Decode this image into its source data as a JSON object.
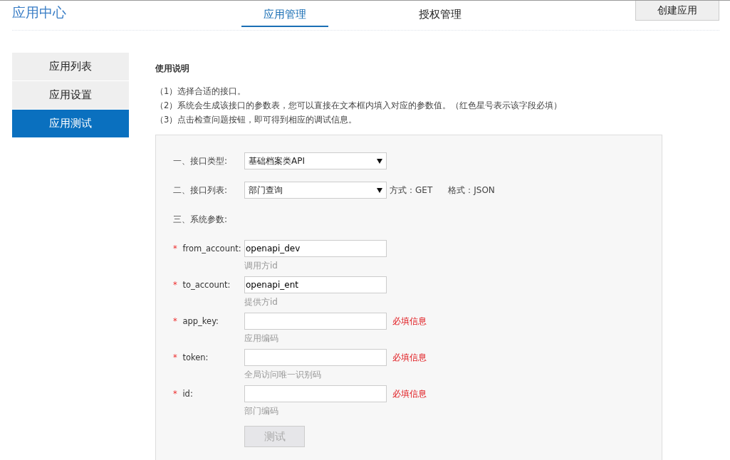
{
  "header": {
    "title": "应用中心",
    "tabs": [
      {
        "label": "应用管理",
        "selected": true
      },
      {
        "label": "授权管理",
        "selected": false
      }
    ],
    "action_button": "创建应用"
  },
  "sidebar": {
    "items": [
      {
        "label": "应用列表",
        "selected": false
      },
      {
        "label": "应用设置",
        "selected": false
      },
      {
        "label": "应用测试",
        "selected": true
      }
    ]
  },
  "instructions": {
    "title": "使用说明",
    "lines": [
      "（1）选择合适的接口。",
      "（2）系统会生成该接口的参数表，您可以直接在文本框内填入对应的参数值。（红色星号表示该字段必填）",
      "（3）点击检查问题按钮，即可得到相应的调试信息。"
    ]
  },
  "form": {
    "api_type": {
      "label": "一、接口类型:",
      "value": "基础档案类API"
    },
    "api_list": {
      "label": "二、接口列表:",
      "value": "部门查询",
      "method": "方式：GET",
      "format": "格式：JSON"
    },
    "params_heading": "三、系统参数:",
    "params": [
      {
        "required_mark": "*",
        "name": "from_account:",
        "value": "openapi_dev",
        "hint": "调用方id"
      },
      {
        "required_mark": "*",
        "name": "to_account:",
        "value": "openapi_ent",
        "hint": "提供方id"
      },
      {
        "required_mark": "*",
        "name": "app_key:",
        "hint": "应用编码",
        "error": "必填信息"
      },
      {
        "required_mark": "*",
        "name": "token:",
        "hint": "全局访问唯一识别码",
        "error": "必填信息"
      },
      {
        "required_mark": "*",
        "name": "id:",
        "hint": "部门编码",
        "error": "必填信息"
      }
    ],
    "test_button": {
      "label": "测试",
      "disabled": true
    }
  }
}
